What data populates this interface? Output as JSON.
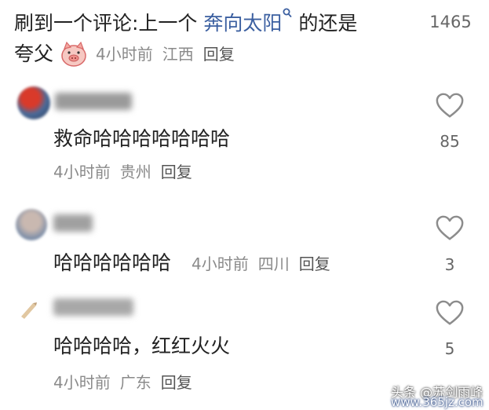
{
  "colors": {
    "link": "#3b5fa0",
    "meta": "#8a8a8a",
    "heart_stroke": "#8c8c8c"
  },
  "top_comment": {
    "text_before_link": "刷到一个评论:上一个 ",
    "link_text": "奔向太阳",
    "search_icon": "search-icon",
    "text_after_link": " 的还是",
    "line2": "夸父",
    "emoji_icon": "pig-face-emoji",
    "time": "4小时前",
    "location": "江西",
    "reply": "回复",
    "like_count": "1465"
  },
  "replies": [
    {
      "avatar_icon": "user-avatar",
      "text": "救命哈哈哈哈哈哈哈",
      "time": "4小时前",
      "location": "贵州",
      "reply": "回复",
      "like_icon": "heart-outline-icon",
      "like_count": "85"
    },
    {
      "avatar_icon": "user-avatar",
      "text": "哈哈哈哈哈哈",
      "time": "4小时前",
      "location": "四川",
      "reply": "回复",
      "like_icon": "heart-outline-icon",
      "like_count": "3"
    },
    {
      "avatar_icon": "user-avatar",
      "text": "哈哈哈哈，红红火火",
      "time": "4小时前",
      "location": "广东",
      "reply": "回复",
      "like_icon": "heart-outline-icon",
      "like_count": "5"
    }
  ],
  "watermark": {
    "line1": "头条 @苏剑雨峰",
    "line2": "www.365jz.com"
  }
}
